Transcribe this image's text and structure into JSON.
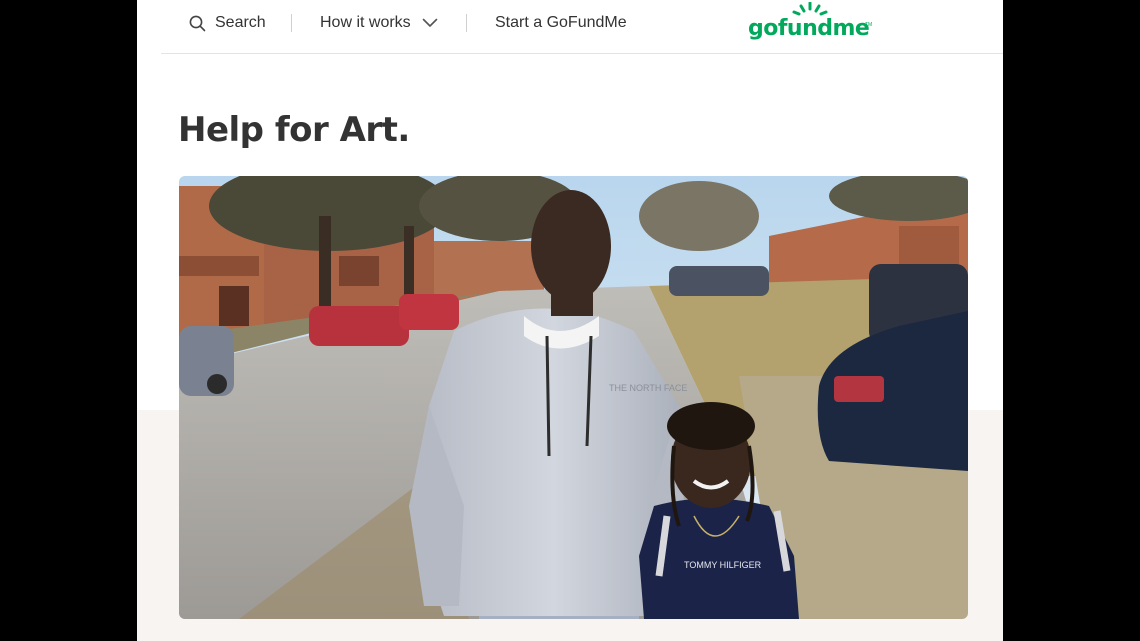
{
  "nav": {
    "search_label": "Search",
    "how_label": "How it works",
    "start_label": "Start a GoFundMe"
  },
  "logo": {
    "text": "gofundme",
    "tm": "TM",
    "color": "#02a95c"
  },
  "campaign": {
    "title": "Help for Art."
  },
  "photo": {
    "shirt_text": "TOMMY HILFIGER",
    "hoodie_logo": "THE NORTH FACE"
  },
  "icons": {
    "search": "search-icon",
    "chevron": "chevron-down-icon",
    "sunburst": "sunburst-icon"
  }
}
